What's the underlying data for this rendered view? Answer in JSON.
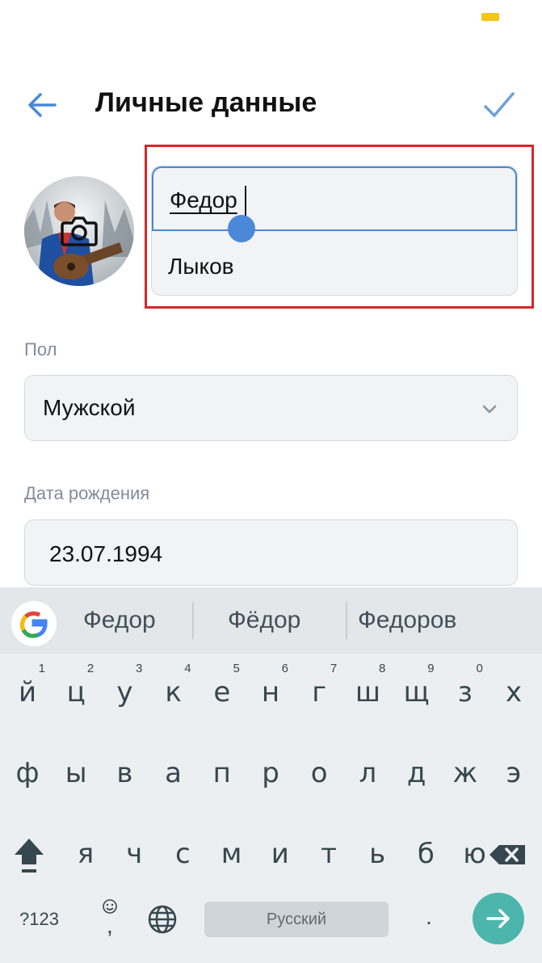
{
  "header": {
    "title": "Личные данные"
  },
  "name_fields": {
    "first_name": "Федор",
    "last_name": "Лыков"
  },
  "gender": {
    "label": "Пол",
    "value": "Мужской"
  },
  "birthdate": {
    "label": "Дата рождения",
    "value": "23.07.1994"
  },
  "keyboard": {
    "suggestions": [
      "Федор",
      "Фёдор",
      "Федоров"
    ],
    "row1": [
      {
        "c": "й",
        "n": "1"
      },
      {
        "c": "ц",
        "n": "2"
      },
      {
        "c": "у",
        "n": "3"
      },
      {
        "c": "к",
        "n": "4"
      },
      {
        "c": "е",
        "n": "5"
      },
      {
        "c": "н",
        "n": "6"
      },
      {
        "c": "г",
        "n": "7"
      },
      {
        "c": "ш",
        "n": "8"
      },
      {
        "c": "щ",
        "n": "9"
      },
      {
        "c": "з",
        "n": "0"
      },
      {
        "c": "х",
        "n": ""
      }
    ],
    "row2": [
      "ф",
      "ы",
      "в",
      "а",
      "п",
      "р",
      "о",
      "л",
      "д",
      "ж",
      "э"
    ],
    "row3": [
      "я",
      "ч",
      "с",
      "м",
      "и",
      "т",
      "ь",
      "б",
      "ю"
    ],
    "symbols_label": "?123",
    "comma": ",",
    "period": ".",
    "space_label": "Русский"
  },
  "colors": {
    "accent": "#4a88d8",
    "highlight_border": "#d7262b",
    "enter_key": "#4cb6ac"
  },
  "icons": [
    "back-arrow-icon",
    "checkmark-icon",
    "camera-icon",
    "chevron-down-icon",
    "google-g-icon",
    "shift-icon",
    "backspace-icon",
    "emoji-icon",
    "globe-icon",
    "enter-arrow-icon"
  ]
}
